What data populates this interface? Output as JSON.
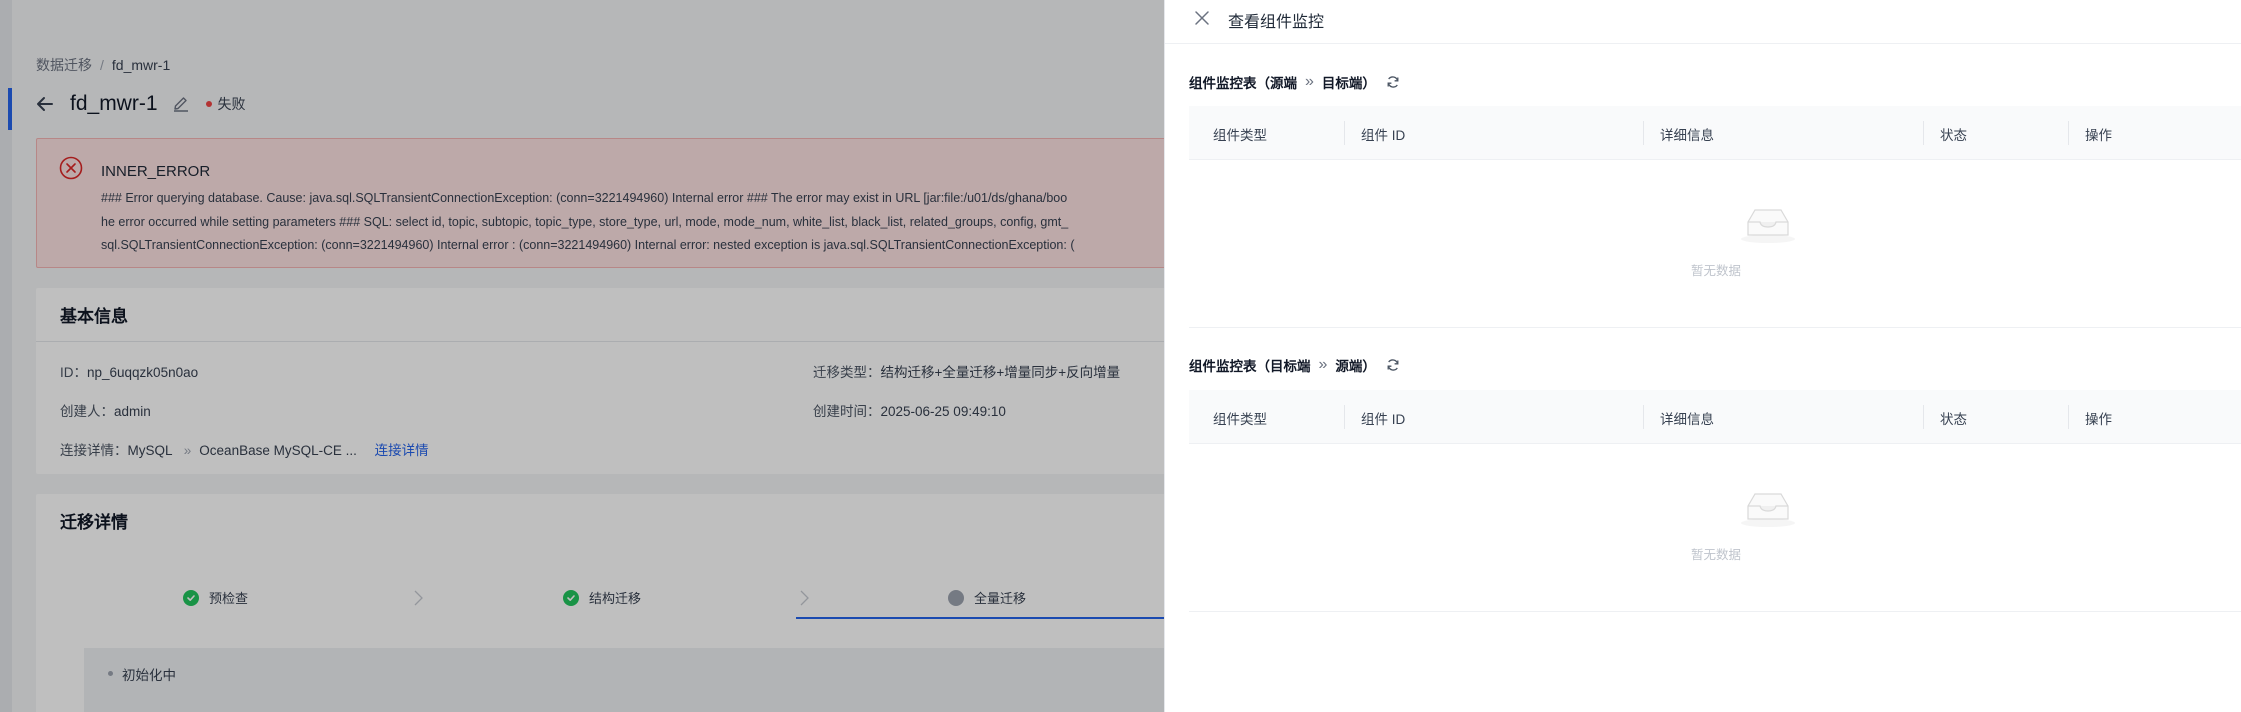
{
  "breadcrumb": {
    "root": "数据迁移",
    "separator": "/",
    "current": "fd_mwr-1"
  },
  "task": {
    "title": "fd_mwr-1",
    "status": "失败"
  },
  "error": {
    "title": "INNER_ERROR",
    "lines": [
      "### Error querying database. Cause: java.sql.SQLTransientConnectionException: (conn=3221494960) Internal error ### The error may exist in URL [jar:file:/u01/ds/ghana/boo",
      "he error occurred while setting parameters ### SQL: select id, topic, subtopic, topic_type, store_type, url, mode, mode_num, white_list, black_list, related_groups, config, gmt_",
      "sql.SQLTransientConnectionException: (conn=3221494960) Internal error : (conn=3221494960) Internal error: nested exception is java.sql.SQLTransientConnectionException: ("
    ]
  },
  "basic_info": {
    "title": "基本信息",
    "id_label": "ID：",
    "id_value": "np_6uqqzk05n0ao",
    "creator_label": "创建人：",
    "creator_value": "admin",
    "conn_label": "连接详情：",
    "conn_source": "MySQL",
    "conn_arrow": "»",
    "conn_target": "OceanBase MySQL-CE ...",
    "conn_link": "连接详情",
    "type_label": "迁移类型：",
    "type_value": "结构迁移+全量迁移+增量同步+反向增量",
    "created_label": "创建时间：",
    "created_value": "2025-06-25 09:49:10"
  },
  "migrate": {
    "title": "迁移详情",
    "steps": [
      {
        "label": "预检查",
        "state": "done"
      },
      {
        "label": "结构迁移",
        "state": "done"
      },
      {
        "label": "全量迁移",
        "state": "pending"
      }
    ],
    "substep": "初始化中"
  },
  "drawer": {
    "title": "查看组件监控",
    "section1": {
      "prefix": "组件监控表（源端",
      "arrow": "»",
      "suffix": "目标端）"
    },
    "section2": {
      "prefix": "组件监控表（目标端",
      "arrow": "»",
      "suffix": "源端）"
    },
    "columns": [
      "组件类型",
      "组件 ID",
      "详细信息",
      "状态",
      "操作"
    ],
    "empty_text": "暂无数据"
  },
  "colors": {
    "accent": "#2563eb",
    "error_bg": "#fde2e2",
    "success": "#22c55e",
    "failed": "#ef4444"
  }
}
